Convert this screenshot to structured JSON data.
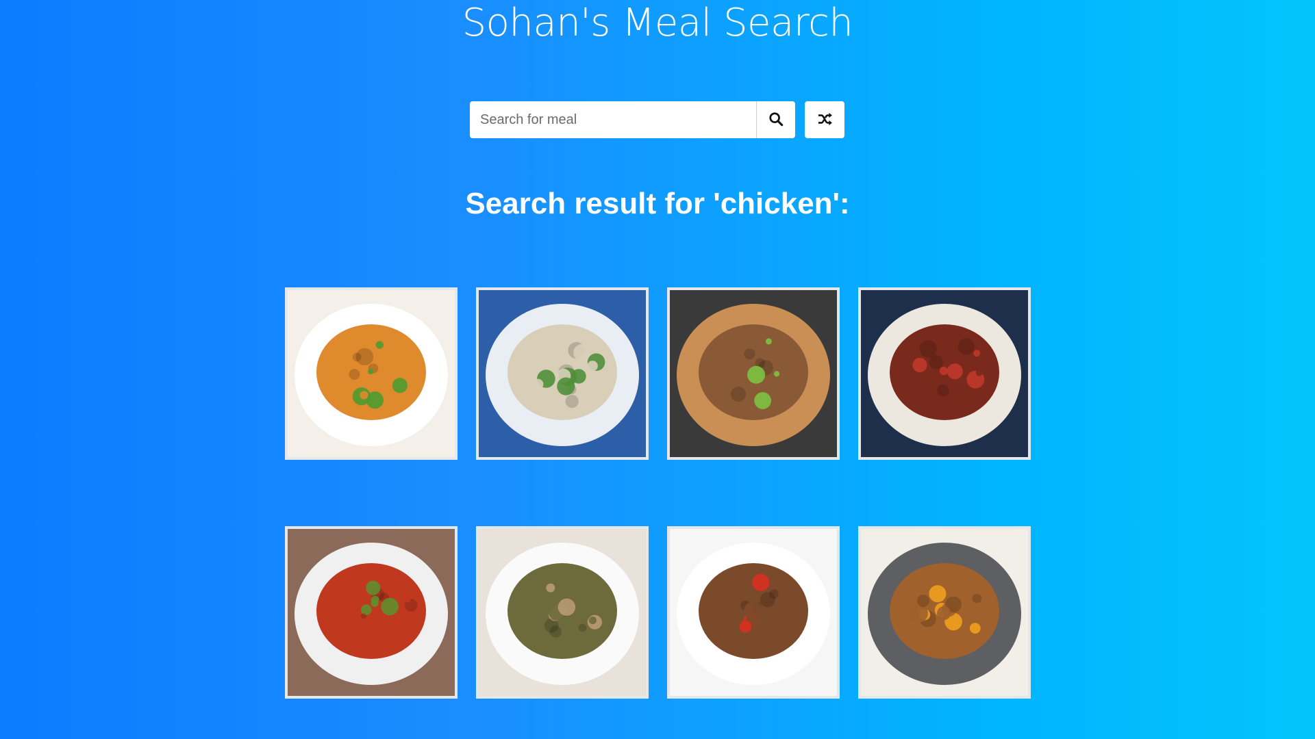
{
  "header": {
    "title": "Sohan's Meal Search"
  },
  "search": {
    "placeholder": "Search for meal",
    "value": "",
    "search_icon": "search-icon",
    "random_icon": "shuffle-icon"
  },
  "results": {
    "heading": "Search result for 'chicken':",
    "meals": [
      {
        "name": "meal-1",
        "bg": "#f4efe9",
        "plate": "#ffffff",
        "food": "#e08a2e",
        "accent": "#4e9a2f"
      },
      {
        "name": "meal-2",
        "bg": "#2c5fa8",
        "plate": "#e9eef5",
        "food": "#d9cfb9",
        "accent": "#4f8f3a"
      },
      {
        "name": "meal-3",
        "bg": "#3a3a3a",
        "plate": "#c98f54",
        "food": "#8a5a36",
        "accent": "#7cc243"
      },
      {
        "name": "meal-4",
        "bg": "#1d2f4a",
        "plate": "#ece7df",
        "food": "#7a2a1c",
        "accent": "#c0392b"
      },
      {
        "name": "meal-5",
        "bg": "#8b6a5a",
        "plate": "#f0f0f0",
        "food": "#c0391f",
        "accent": "#5f8f2e"
      },
      {
        "name": "meal-6",
        "bg": "#e8e2da",
        "plate": "#fafafa",
        "food": "#6d6a3c",
        "accent": "#b99a74"
      },
      {
        "name": "meal-7",
        "bg": "#f6f6f6",
        "plate": "#ffffff",
        "food": "#7b4a2a",
        "accent": "#d8301f"
      },
      {
        "name": "meal-8",
        "bg": "#f2efe8",
        "plate": "#5d5f63",
        "food": "#a0612c",
        "accent": "#f0a11f"
      }
    ]
  }
}
